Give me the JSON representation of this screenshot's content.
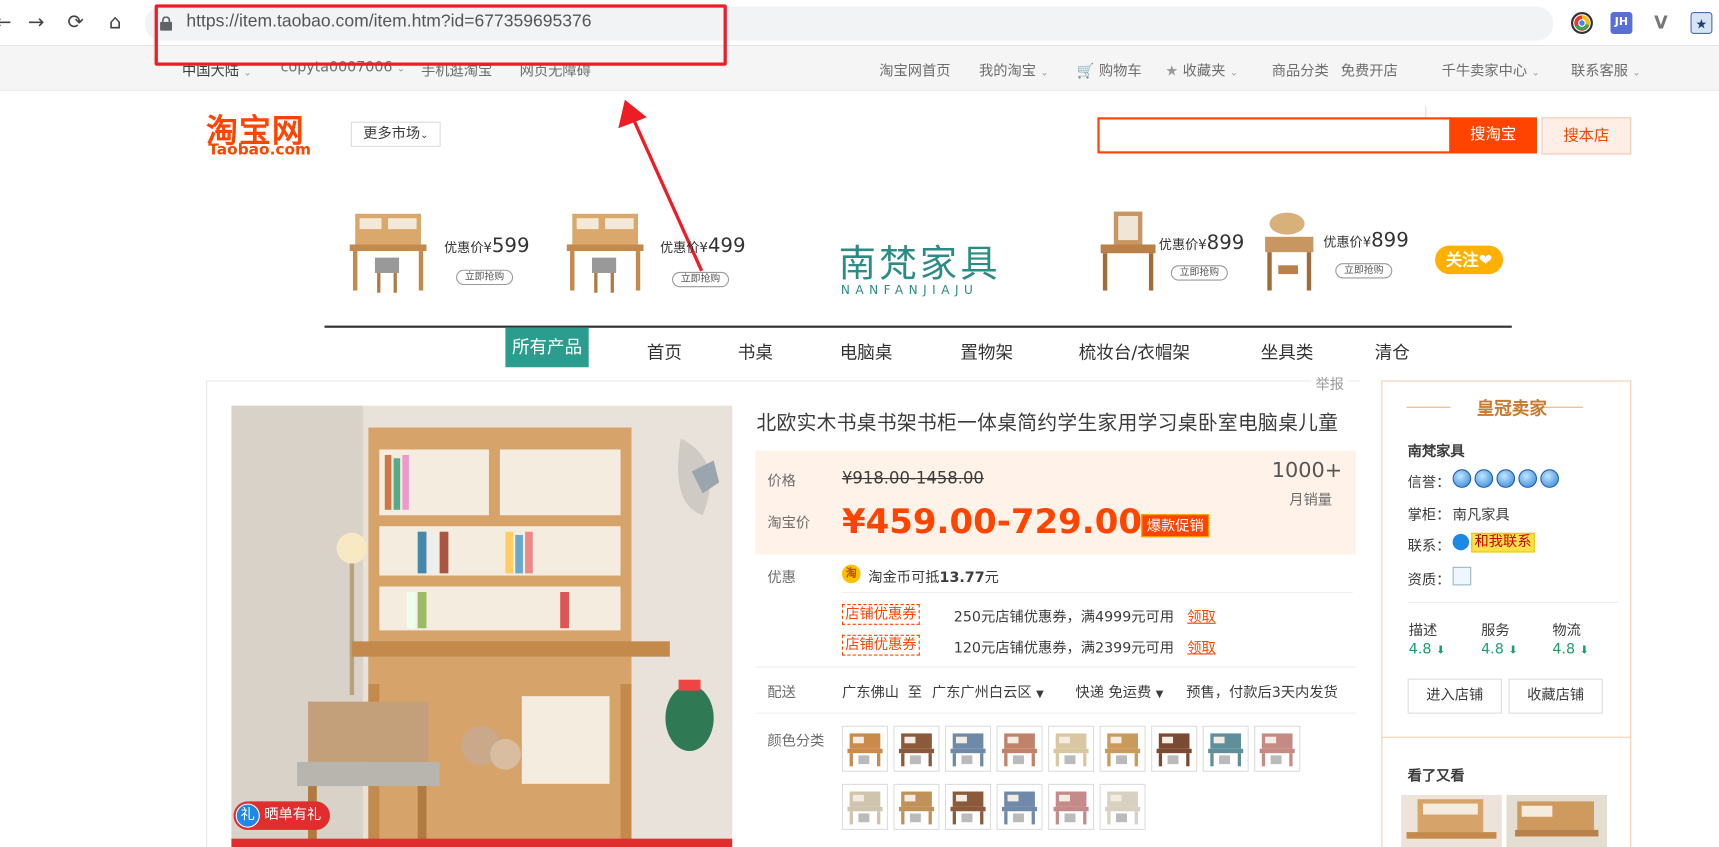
{
  "browser": {
    "url": "https://item.taobao.com/item.htm?id=677359695376",
    "extensions": [
      "chrome-icon",
      "JH",
      "vue-icon",
      "bookmark-icon"
    ]
  },
  "site_nav": {
    "region": "中国大陆",
    "user": "copyta0007006",
    "mobile": "手机逛淘宝",
    "accessible": "网页无障碍",
    "home": "淘宝网首页",
    "my_taobao": "我的淘宝",
    "cart": "购物车",
    "favorites": "收藏夹",
    "categories": "商品分类",
    "open_shop": "免费开店",
    "seller_center": "千牛卖家中心",
    "service": "联系客服"
  },
  "header": {
    "logo_cn": "淘宝网",
    "logo_en": "Taobao.com",
    "more_market": "更多市场",
    "search_button": "搜淘宝",
    "search_shop_button": "搜本店",
    "search_placeholder": ""
  },
  "banner": {
    "brand_cn": "南梵家具",
    "brand_en": "NANFANJIAJU",
    "price_label": "优惠价",
    "currency": "¥",
    "buy_label": "立即抢购",
    "follow": "关注❤",
    "prices": [
      "599",
      "499",
      "899",
      "899"
    ]
  },
  "categories": [
    "所有产品",
    "首页",
    "书桌",
    "电脑桌",
    "置物架",
    "梳妆台/衣帽架",
    "坐具类",
    "清仓"
  ],
  "product": {
    "report": "举报",
    "title": "北欧实木书桌书架书柜一体桌简约学生家用学习桌卧室电脑桌儿童",
    "price_label": "价格",
    "orig_price": "¥918.00-1458.00",
    "tb_price_label": "淘宝价",
    "tb_price": "¥459.00-729.00",
    "promo_tag": "爆款促销",
    "monthly_sales": "1000+",
    "monthly_sales_label": "月销量",
    "discount_label": "优惠",
    "coin_icon": "淘",
    "coin_text_a": "淘金币可抵",
    "coin_amount": "13.77",
    "coin_text_b": "元",
    "coupon_tag": "店铺优惠券",
    "coupons": [
      {
        "text": "250元店铺优惠券，满4999元可用",
        "claim": "领取"
      },
      {
        "text": "120元店铺优惠券，满2399元可用",
        "claim": "领取"
      }
    ],
    "delivery_label": "配送",
    "from": "广东佛山",
    "to_word": "至",
    "to": "广东广州白云区",
    "express": "快递 免运费",
    "presale": "预售，付款后3天内发货",
    "color_label": "颜色分类",
    "gift_badge": "晒单有礼",
    "gift_icon": "礼"
  },
  "seller": {
    "crown": "皇冠卖家",
    "name": "南梵家具",
    "credit_label": "信誉：",
    "keeper_label": "掌柜：",
    "keeper": "南凡家具",
    "contact_label": "联系：",
    "contact_btn": "和我联系",
    "qual_label": "资质：",
    "scores": [
      {
        "label": "描述",
        "value": "4.8"
      },
      {
        "label": "服务",
        "value": "4.8"
      },
      {
        "label": "物流",
        "value": "4.8"
      }
    ],
    "enter_shop": "进入店铺",
    "fav_shop": "收藏店铺",
    "see_also": "看了又看"
  },
  "colors": {
    "taobao_orange": "#ff4400",
    "brand_teal": "#2a9d8f",
    "annotation_red": "#ee1c25"
  }
}
